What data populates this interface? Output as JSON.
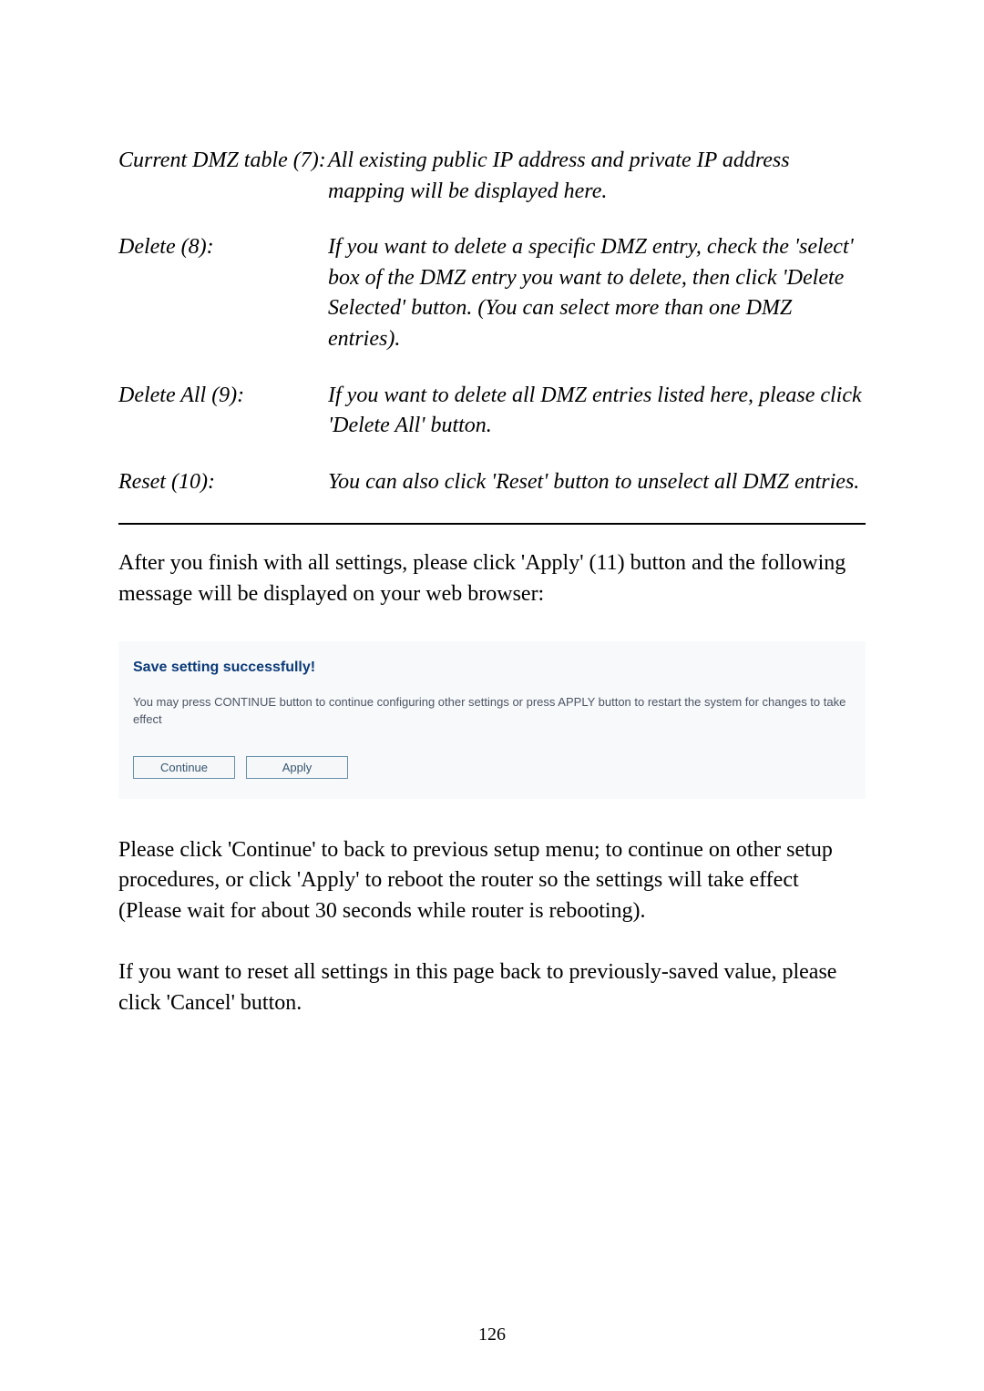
{
  "defs": [
    {
      "term": "Current DMZ table (7):",
      "desc": "All existing public IP address and private IP address mapping will be displayed here."
    },
    {
      "term": "Delete (8):",
      "desc": "If you want to delete a specific DMZ entry, check the 'select' box of the DMZ entry you want to delete, then click 'Delete Selected' button. (You can select more than one DMZ entries)."
    },
    {
      "term": "Delete All (9):",
      "desc": "If you want to delete all DMZ entries listed here, please click 'Delete All' button."
    },
    {
      "term": "Reset (10):",
      "desc": "You can also click 'Reset' button to unselect all DMZ entries."
    }
  ],
  "para_after_table": "After you finish with all settings, please click 'Apply' (11) button and the following message will be displayed on your web browser:",
  "dialog": {
    "title": "Save setting successfully!",
    "message": "You may press CONTINUE button to continue configuring other settings or press APPLY button to restart the system for changes to take effect",
    "continue_label": "Continue",
    "apply_label": "Apply"
  },
  "para_explain": "Please click 'Continue' to back to previous setup menu; to continue on other setup procedures, or click 'Apply' to reboot the router so the settings will take effect (Please wait for about 30 seconds while router is rebooting).",
  "para_reset": "If you want to reset all settings in this page back to previously-saved value, please click 'Cancel' button.",
  "page_number": "126"
}
